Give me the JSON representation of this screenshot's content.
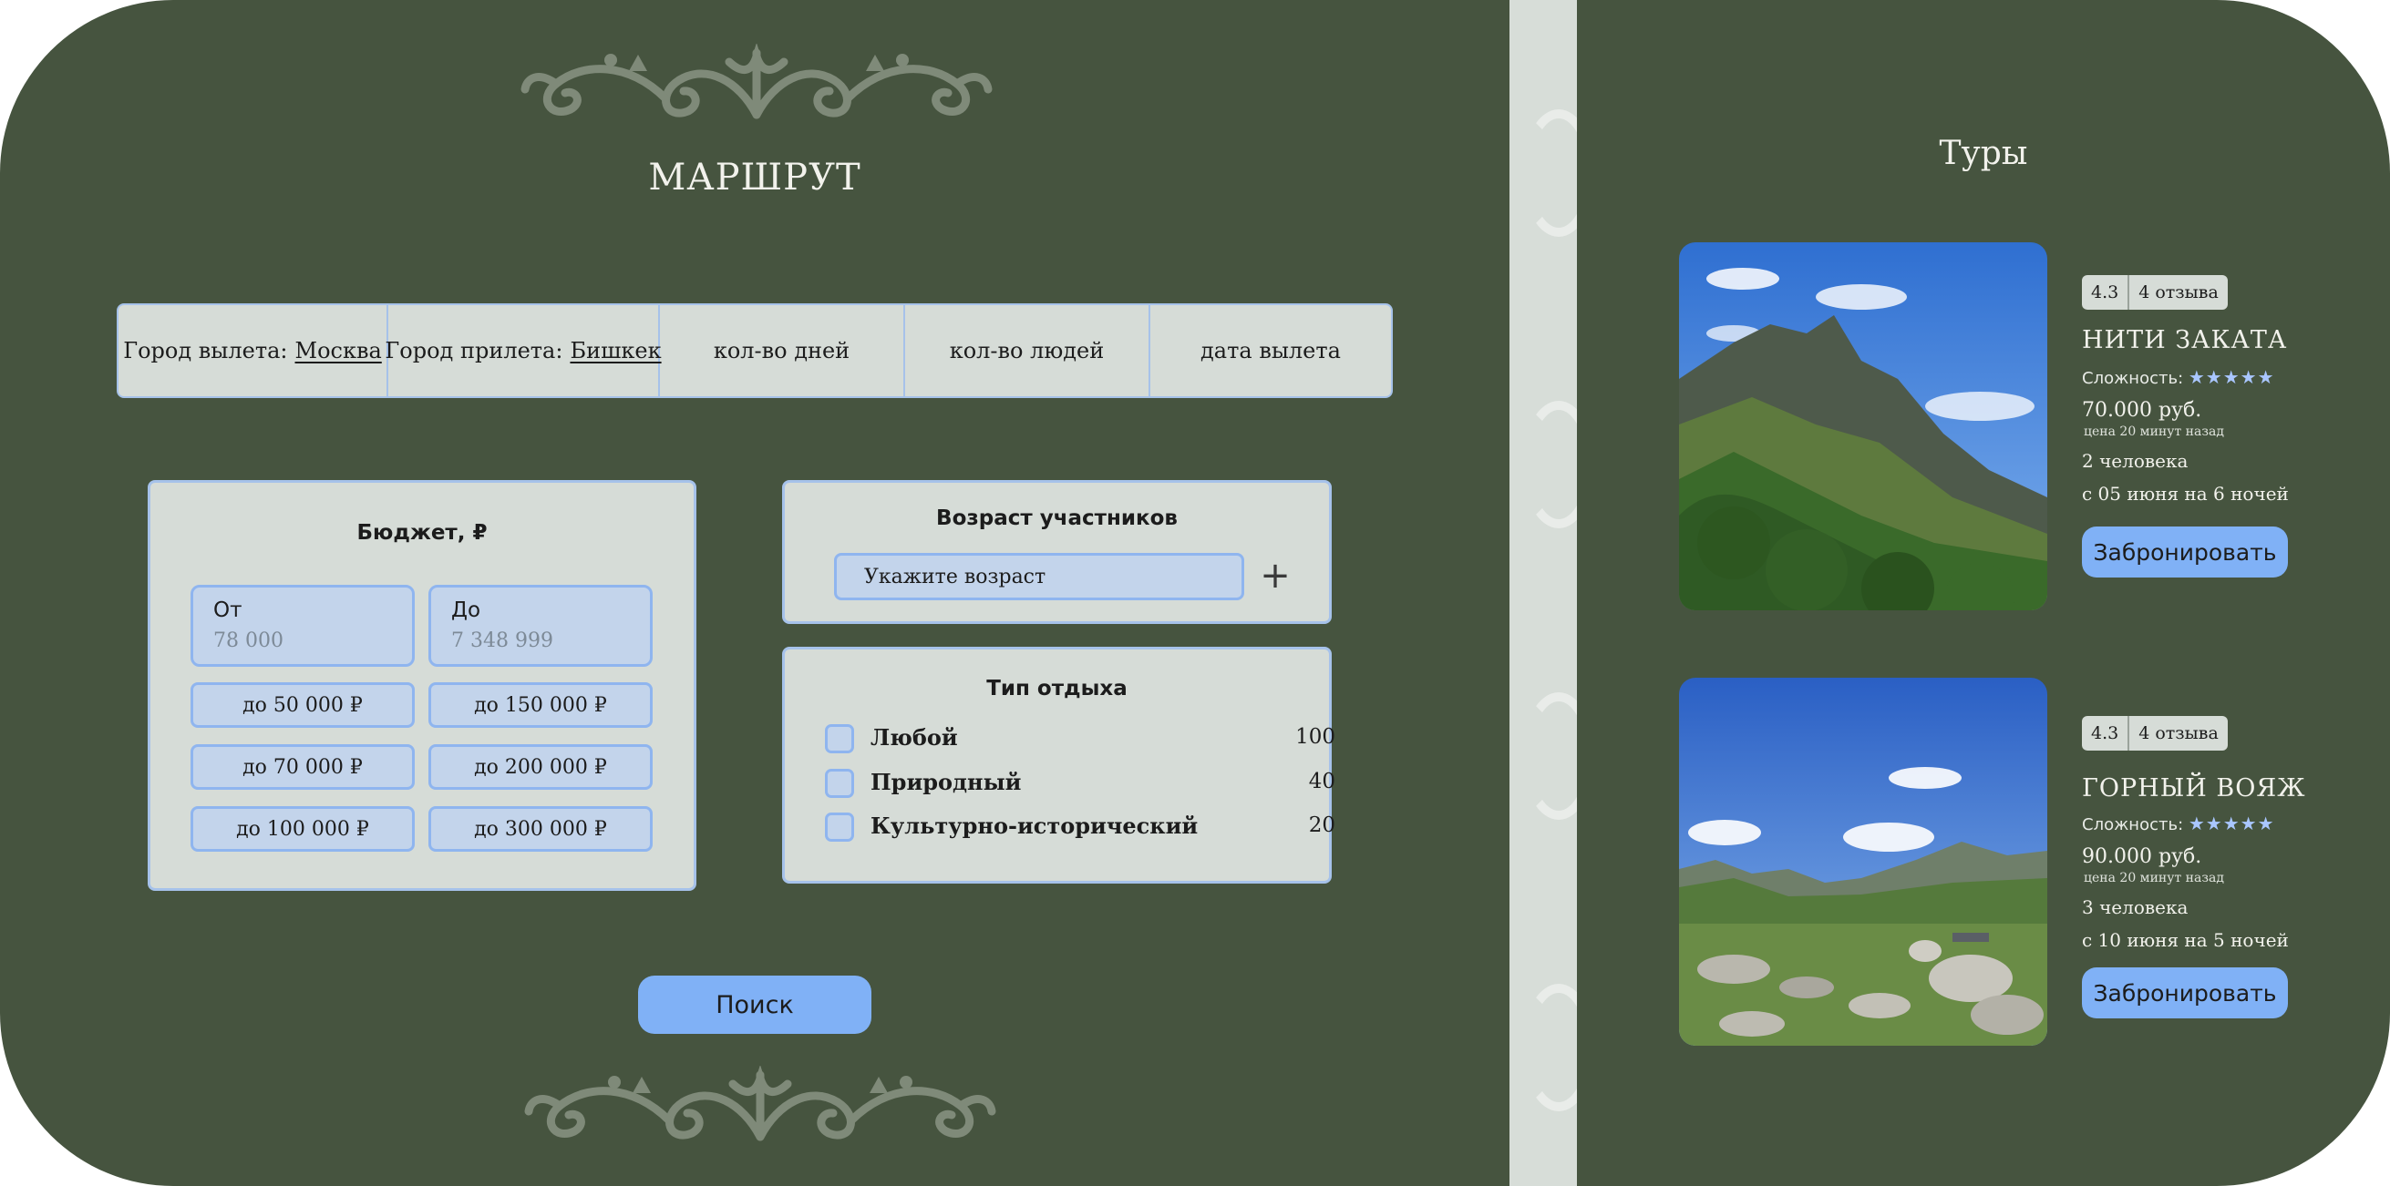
{
  "route": {
    "title": "МАРШРУТ",
    "bar": {
      "departure_label": "Город вылета:",
      "departure_value": "Москва",
      "arrival_label": "Город прилета:",
      "arrival_value": "Бишкек",
      "days_label": "кол-во дней",
      "people_label": "кол-во людей",
      "date_label": "дата вылета"
    }
  },
  "budget": {
    "title": "Бюджет, ₽",
    "from_label": "От",
    "from_value": "78 000",
    "to_label": "До",
    "to_value": "7 348 999",
    "presets": [
      "до 50 000 ₽",
      "до 150 000 ₽",
      "до 70 000 ₽",
      "до 200 000 ₽",
      "до 100 000 ₽",
      "до 300 000 ₽"
    ]
  },
  "ages": {
    "title": "Возраст участников",
    "placeholder": "Укажите возраст",
    "add_icon": "+"
  },
  "rest_type": {
    "title": "Тип отдыха",
    "options": [
      {
        "label": "Любой",
        "count": "100"
      },
      {
        "label": "Природный",
        "count": "40"
      },
      {
        "label": "Культурно-исторический",
        "count": "20"
      }
    ]
  },
  "search_button": "Поиск",
  "tours": {
    "title": "Туры",
    "items": [
      {
        "rating": "4.3",
        "reviews": "4 отзыва",
        "name": "НИТИ ЗАКАТА",
        "difficulty_label": "Сложность:",
        "stars": "★★★★★",
        "price": "70.000 руб.",
        "price_note": "цена 20 минут назад",
        "people": "2 человека",
        "dates": "с 05 июня на 6 ночей",
        "book_label": "Забронировать"
      },
      {
        "rating": "4.3",
        "reviews": "4 отзыва",
        "name": "ГОРНЫЙ ВОЯЖ",
        "difficulty_label": "Сложность:",
        "stars": "★★★★★",
        "price": "90.000 руб.",
        "price_note": "цена 20 минут назад",
        "people": "3 человека",
        "dates": "с 10 июня на 5 ночей",
        "book_label": "Забронировать"
      }
    ]
  },
  "colors": {
    "panel": "#46543f",
    "card": "#d6dcd7",
    "field": "#c3d4eb",
    "accent": "#80b1f6",
    "border": "#a6c2ea"
  }
}
